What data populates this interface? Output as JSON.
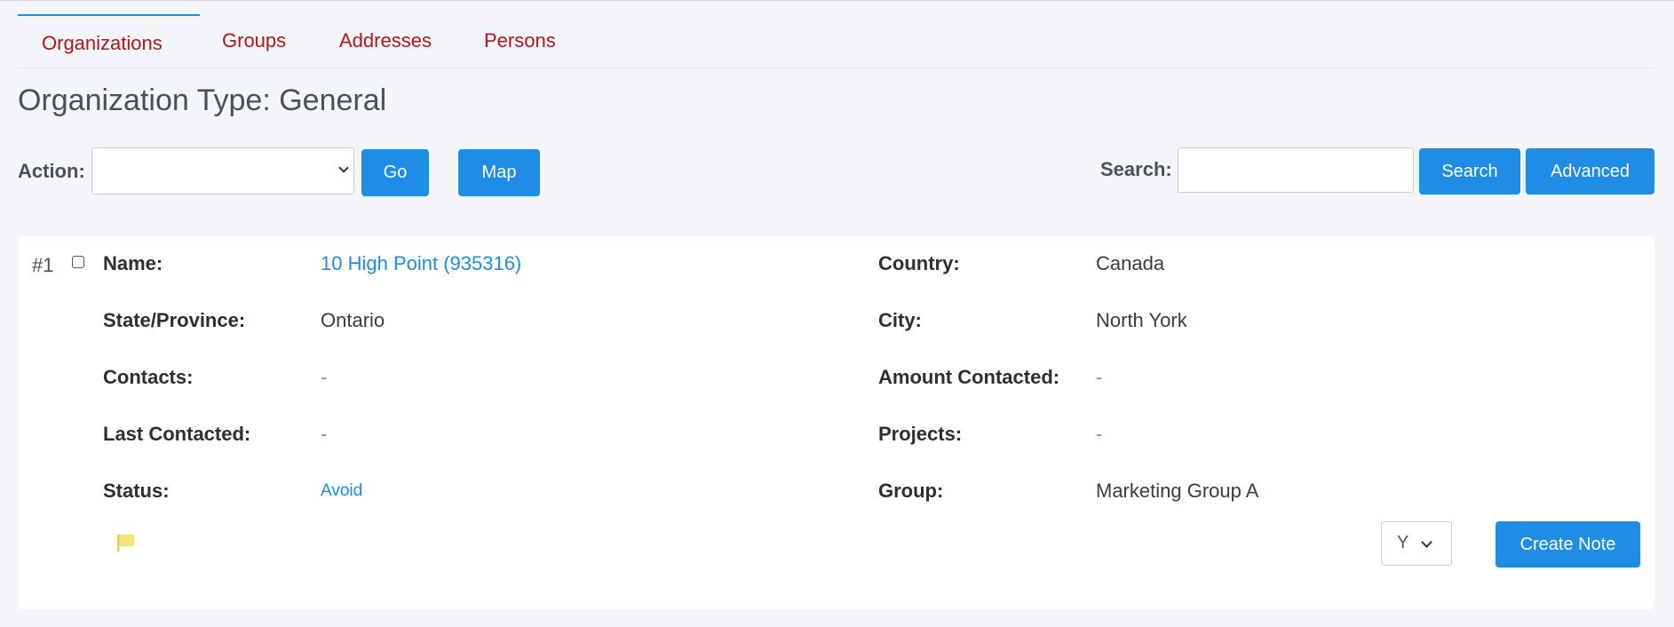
{
  "tabs": [
    {
      "label": "Organizations",
      "active": true
    },
    {
      "label": "Groups"
    },
    {
      "label": "Addresses"
    },
    {
      "label": "Persons"
    }
  ],
  "page_title": "Organization Type: General",
  "toolbar": {
    "action_label": "Action:",
    "action_value": "",
    "go_label": "Go",
    "map_label": "Map",
    "search_label": "Search:",
    "search_value": "",
    "search_button": "Search",
    "advanced_button": "Advanced"
  },
  "record": {
    "number": "#1",
    "fields": {
      "name_label": "Name:",
      "name_value": "10 High Point (935316)",
      "country_label": "Country:",
      "country_value": "Canada",
      "state_label": "State/Province:",
      "state_value": "Ontario",
      "city_label": "City:",
      "city_value": "North York",
      "contacts_label": "Contacts:",
      "contacts_value": "-",
      "amount_label": "Amount Contacted:",
      "amount_value": "-",
      "last_label": "Last Contacted:",
      "last_value": "-",
      "projects_label": "Projects:",
      "projects_value": "-",
      "status_label": "Status:",
      "status_value": "Avoid",
      "group_label": "Group:",
      "group_value": "Marketing Group A"
    },
    "flag_icon": "flag-icon",
    "flag_color": "#f2e27a",
    "select_value": "Y",
    "create_note_label": "Create Note"
  },
  "colors": {
    "accent": "#1f8ce6",
    "tab_text": "#b4161b"
  }
}
